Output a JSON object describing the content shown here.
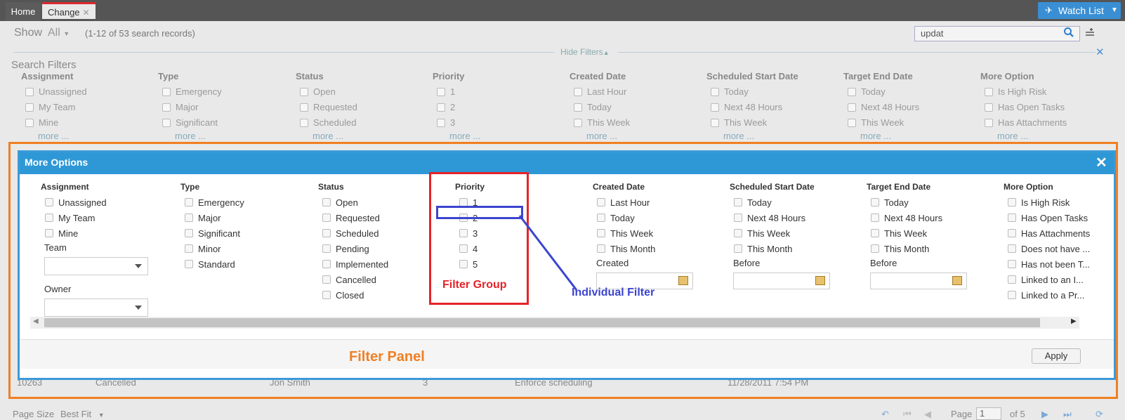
{
  "tabs": [
    {
      "label": "Home"
    },
    {
      "label": "Change",
      "close": "✕"
    }
  ],
  "watchlist": {
    "label": "Watch List"
  },
  "toolbar": {
    "show_label": "Show",
    "show_value": "All",
    "records": "(1-12 of 53 search records)",
    "search_value": "updat",
    "hide_filters": "Hide Filters"
  },
  "background_filters": {
    "title": "Search Filters",
    "more": "more ...",
    "columns": [
      {
        "heading": "Assignment",
        "items": [
          "Unassigned",
          "My Team",
          "Mine"
        ]
      },
      {
        "heading": "Type",
        "items": [
          "Emergency",
          "Major",
          "Significant"
        ]
      },
      {
        "heading": "Status",
        "items": [
          "Open",
          "Requested",
          "Scheduled"
        ]
      },
      {
        "heading": "Priority",
        "items": [
          "1",
          "2",
          "3"
        ]
      },
      {
        "heading": "Created Date",
        "items": [
          "Last Hour",
          "Today",
          "This Week"
        ]
      },
      {
        "heading": "Scheduled Start Date",
        "items": [
          "Today",
          "Next 48 Hours",
          "This Week"
        ]
      },
      {
        "heading": "Target End Date",
        "items": [
          "Today",
          "Next 48 Hours",
          "This Week"
        ]
      },
      {
        "heading": "More Option",
        "items": [
          "Is High Risk",
          "Has Open Tasks",
          "Has Attachments"
        ]
      }
    ]
  },
  "table_row": {
    "id": "10263",
    "status": "Cancelled",
    "owner": "Jon Smith",
    "priority": "3",
    "summary": "Enforce scheduling",
    "date": "11/28/2011 7:54 PM"
  },
  "modal": {
    "title": "More Options",
    "close": "✕",
    "apply": "Apply",
    "assignment": {
      "heading": "Assignment",
      "items": [
        "Unassigned",
        "My Team",
        "Mine"
      ],
      "team_label": "Team",
      "owner_label": "Owner"
    },
    "type": {
      "heading": "Type",
      "items": [
        "Emergency",
        "Major",
        "Significant",
        "Minor",
        "Standard"
      ]
    },
    "status": {
      "heading": "Status",
      "items": [
        "Open",
        "Requested",
        "Scheduled",
        "Pending",
        "Implemented",
        "Cancelled",
        "Closed"
      ]
    },
    "priority": {
      "heading": "Priority",
      "items": [
        "1",
        "2",
        "3",
        "4",
        "5"
      ]
    },
    "created": {
      "heading": "Created Date",
      "items": [
        "Last Hour",
        "Today",
        "This Week",
        "This Month"
      ],
      "sub_label": "Created"
    },
    "scheduled": {
      "heading": "Scheduled Start Date",
      "items": [
        "Today",
        "Next 48 Hours",
        "This Week",
        "This Month"
      ],
      "sub_label": "Before"
    },
    "target": {
      "heading": "Target End Date",
      "items": [
        "Today",
        "Next 48 Hours",
        "This Week",
        "This Month"
      ],
      "sub_label": "Before"
    },
    "more_option": {
      "heading": "More Option",
      "items": [
        "Is High Risk",
        "Has Open Tasks",
        "Has Attachments",
        "Does not have ...",
        "Has not been T...",
        "Linked to an I...",
        "Linked to a Pr..."
      ]
    }
  },
  "annotations": {
    "filter_group": "Filter Group",
    "individual_filter": "Individual Filter",
    "filter_panel": "Filter Panel"
  },
  "pager": {
    "page_size_label": "Page Size",
    "page_size_value": "Best Fit",
    "page_label": "Page",
    "page_value": "1",
    "of_label": "of 5"
  },
  "colors": {
    "accent": "#2e98d6",
    "annotation_red": "#e52329",
    "annotation_blue": "#3c45cf",
    "annotation_orange": "#f07f23"
  }
}
